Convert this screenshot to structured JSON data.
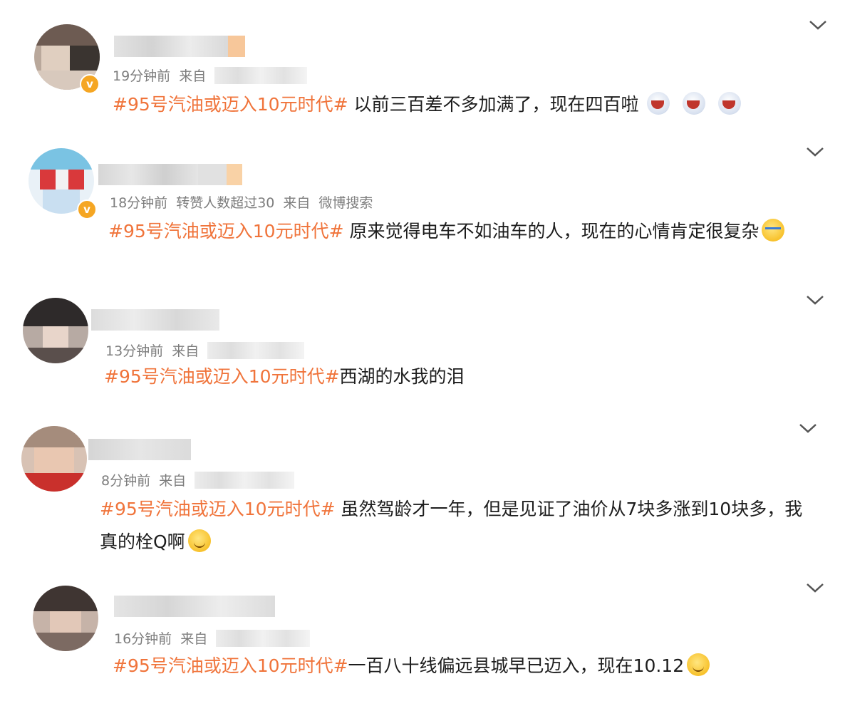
{
  "comments": [
    {
      "time": "19分钟前",
      "extra": "",
      "source_label": "来自",
      "source": "",
      "tag": "#95号汽油或迈入10元时代#",
      "text": " 以前三百差不多加满了，现在四百啦",
      "emojis": [
        "scream-crying-emoji",
        "scream-crying-emoji",
        "scream-crying-emoji"
      ],
      "verified": true
    },
    {
      "time": "18分钟前",
      "extra": "转赞人数超过30",
      "source_label": "来自",
      "source": "微博搜索",
      "tag": "#95号汽油或迈入10元时代#",
      "text": " 原来觉得电车不如油车的人，现在的心情肯定很复杂",
      "emojis": [
        "crying-emoji"
      ],
      "verified": true
    },
    {
      "time": "13分钟前",
      "extra": "",
      "source_label": "来自",
      "source": "",
      "tag": "#95号汽油或迈入10元时代#",
      "text": "西湖的水我的泪",
      "emojis": [],
      "verified": false
    },
    {
      "time": "8分钟前",
      "extra": "",
      "source_label": "来自",
      "source": "",
      "tag": "#95号汽油或迈入10元时代#",
      "text": " 虽然驾龄才一年，但是见证了油价从7块多涨到10块多，我",
      "text_line2": "真的栓Q啊",
      "emojis": [
        "tearful-smile-emoji"
      ],
      "verified": false
    },
    {
      "time": "16分钟前",
      "extra": "",
      "source_label": "来自",
      "source": "",
      "tag": "#95号汽油或迈入10元时代#",
      "text": "一百八十线偏远县城早已迈入，现在10.12",
      "emojis": [
        "smile-emoji"
      ],
      "verified": false
    }
  ],
  "colors": {
    "tag": "#f0743b",
    "meta": "#7d7d7d",
    "badge": "#f5a623"
  },
  "icons": {
    "more": "chevron-down-icon",
    "verified": "verified-v-badge-icon"
  }
}
